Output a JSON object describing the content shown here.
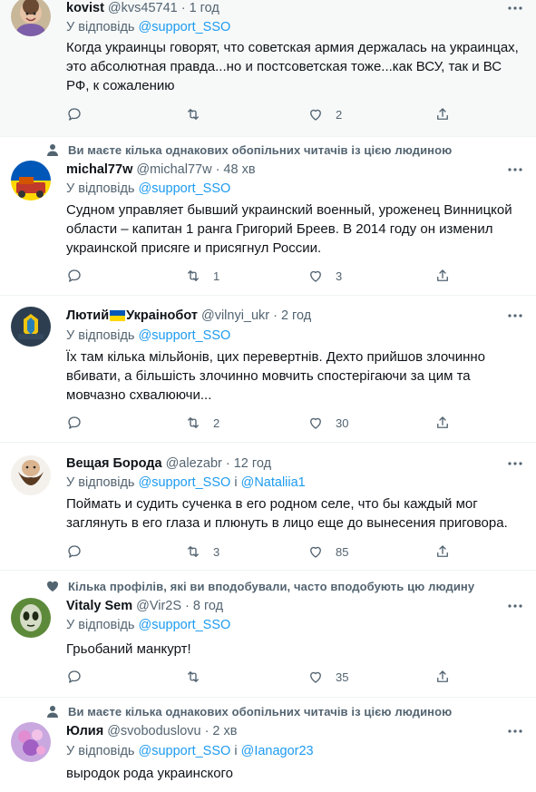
{
  "icons": {
    "more": "more-icon",
    "reply": "reply-icon",
    "retweet": "retweet-icon",
    "like": "like-icon",
    "share": "share-icon"
  },
  "colors": {
    "link": "#1d9bf0",
    "secondary": "#536471",
    "text": "#0f1419",
    "highlight_bg": "#f7f9f9"
  },
  "tweets": [
    {
      "name": "kovist",
      "handle": "@kvs45741",
      "dot": "·",
      "time": "1 год",
      "reply_prefix": "У відповідь",
      "reply_to_1": "@support_SSO",
      "text": "Когда украинцы говорят, что советская армия держалась на украинцах, это абсолютная правда...но и постсоветская тоже...как ВСУ, так и ВС РФ, к сожалению",
      "retweets": "",
      "likes": "2"
    },
    {
      "social_context": "Ви маєте кілька однакових обопільних читачів із цією людиною",
      "name": "michal77w",
      "handle": "@michal77w",
      "dot": "·",
      "time": "48 хв",
      "reply_prefix": "У відповідь",
      "reply_to_1": "@support_SSO",
      "text": "Судном управляет бывший украинский военный, уроженец Винницкой области – капитан 1 ранга Григорий Бреев. В 2014 году он изменил украинской присяге и присягнул России.",
      "retweets": "1",
      "likes": "3"
    },
    {
      "name_part1": "Лютий",
      "name_part2": "Украінобот",
      "handle": "@vilnyi_ukr",
      "dot": "·",
      "time": "2 год",
      "reply_prefix": "У відповідь",
      "reply_to_1": "@support_SSO",
      "text": "Їх там кілька мільйонів, цих перевертнів. Дехто прийшов злочинно вбивати, а більшість злочинно мовчить спостерігаючи за цим та мовчазно схвалюючи...",
      "retweets": "2",
      "likes": "30"
    },
    {
      "name": "Вещая Борода",
      "handle": "@alezabr",
      "dot": "·",
      "time": "12 год",
      "reply_prefix": "У відповідь",
      "reply_to_1": "@support_SSO",
      "reply_joiner": "і",
      "reply_to_2": "@Nataliia1",
      "text": "Поймать и судить сученка в его родном селе, что бы каждый мог заглянуть в его глаза и плюнуть в лицо еще до вынесения приговора.",
      "retweets": "3",
      "likes": "85"
    },
    {
      "social_context": "Кілька профілів, які ви вподобували, часто вподобують цю людину",
      "name": "Vitaly Sem",
      "handle": "@Vir2S",
      "dot": "·",
      "time": "8 год",
      "reply_prefix": "У відповідь",
      "reply_to_1": "@support_SSO",
      "text": "Грьобаний манкурт!",
      "retweets": "",
      "likes": "35"
    },
    {
      "social_context": "Ви маєте кілька однакових обопільних читачів із цією людиною",
      "name": "Юлия",
      "handle": "@svoboduslovu",
      "dot": "·",
      "time": "2 хв",
      "reply_prefix": "У відповідь",
      "reply_to_1": "@support_SSO",
      "reply_joiner": "і",
      "reply_to_2": "@Ianagor23",
      "text": "выродок рода украинского"
    }
  ]
}
